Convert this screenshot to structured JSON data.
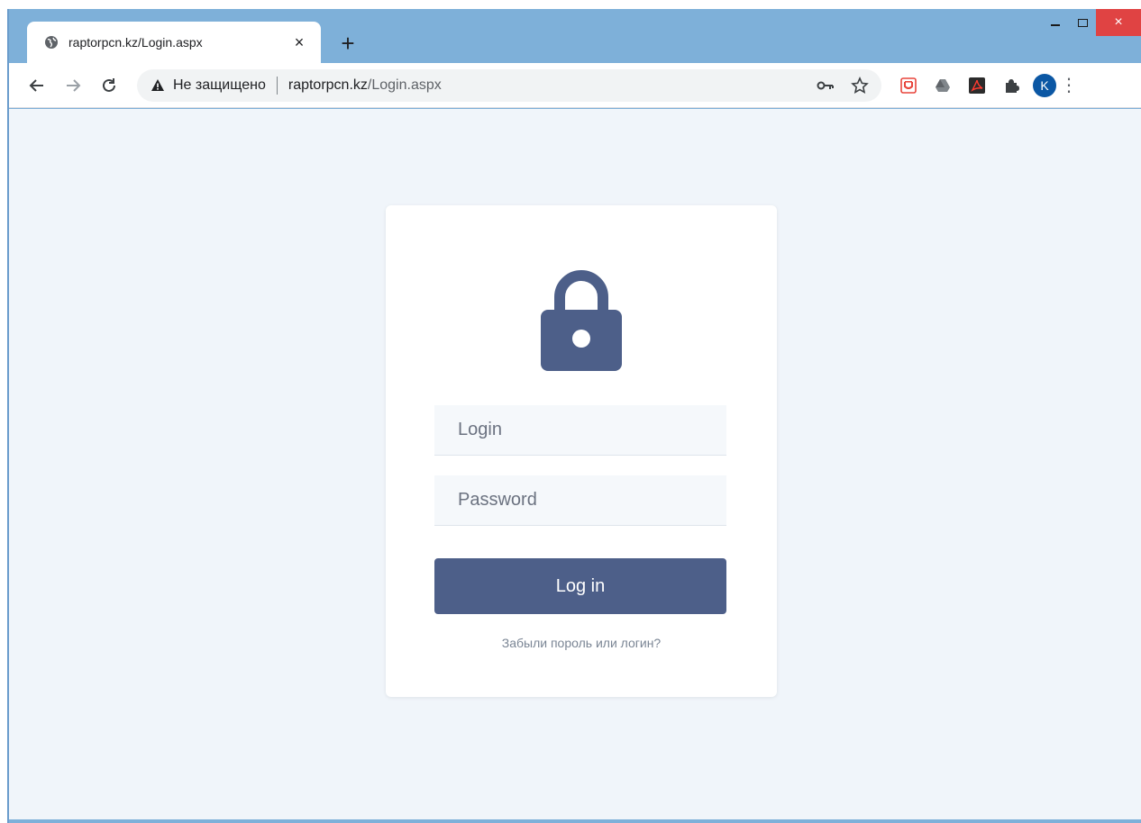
{
  "browser": {
    "tab": {
      "title": "raptorpcn.kz/Login.aspx",
      "close_glyph": "×"
    },
    "newtab_glyph": "+",
    "address": {
      "security_label": "Не защищено",
      "url_host": "raptorpcn.kz",
      "url_path": "/Login.aspx"
    },
    "profile_initial": "K",
    "menu_glyph": "⋮",
    "window_close_glyph": "×"
  },
  "login_form": {
    "login_placeholder": "Login",
    "password_placeholder": "Password",
    "submit_label": "Log in",
    "forgot_link": "Забыли пороль или логин?"
  },
  "colors": {
    "accent": "#4d5f89",
    "page_bg": "#f0f5fa",
    "frame": "#7eb0d9",
    "close_red": "#e04343"
  }
}
